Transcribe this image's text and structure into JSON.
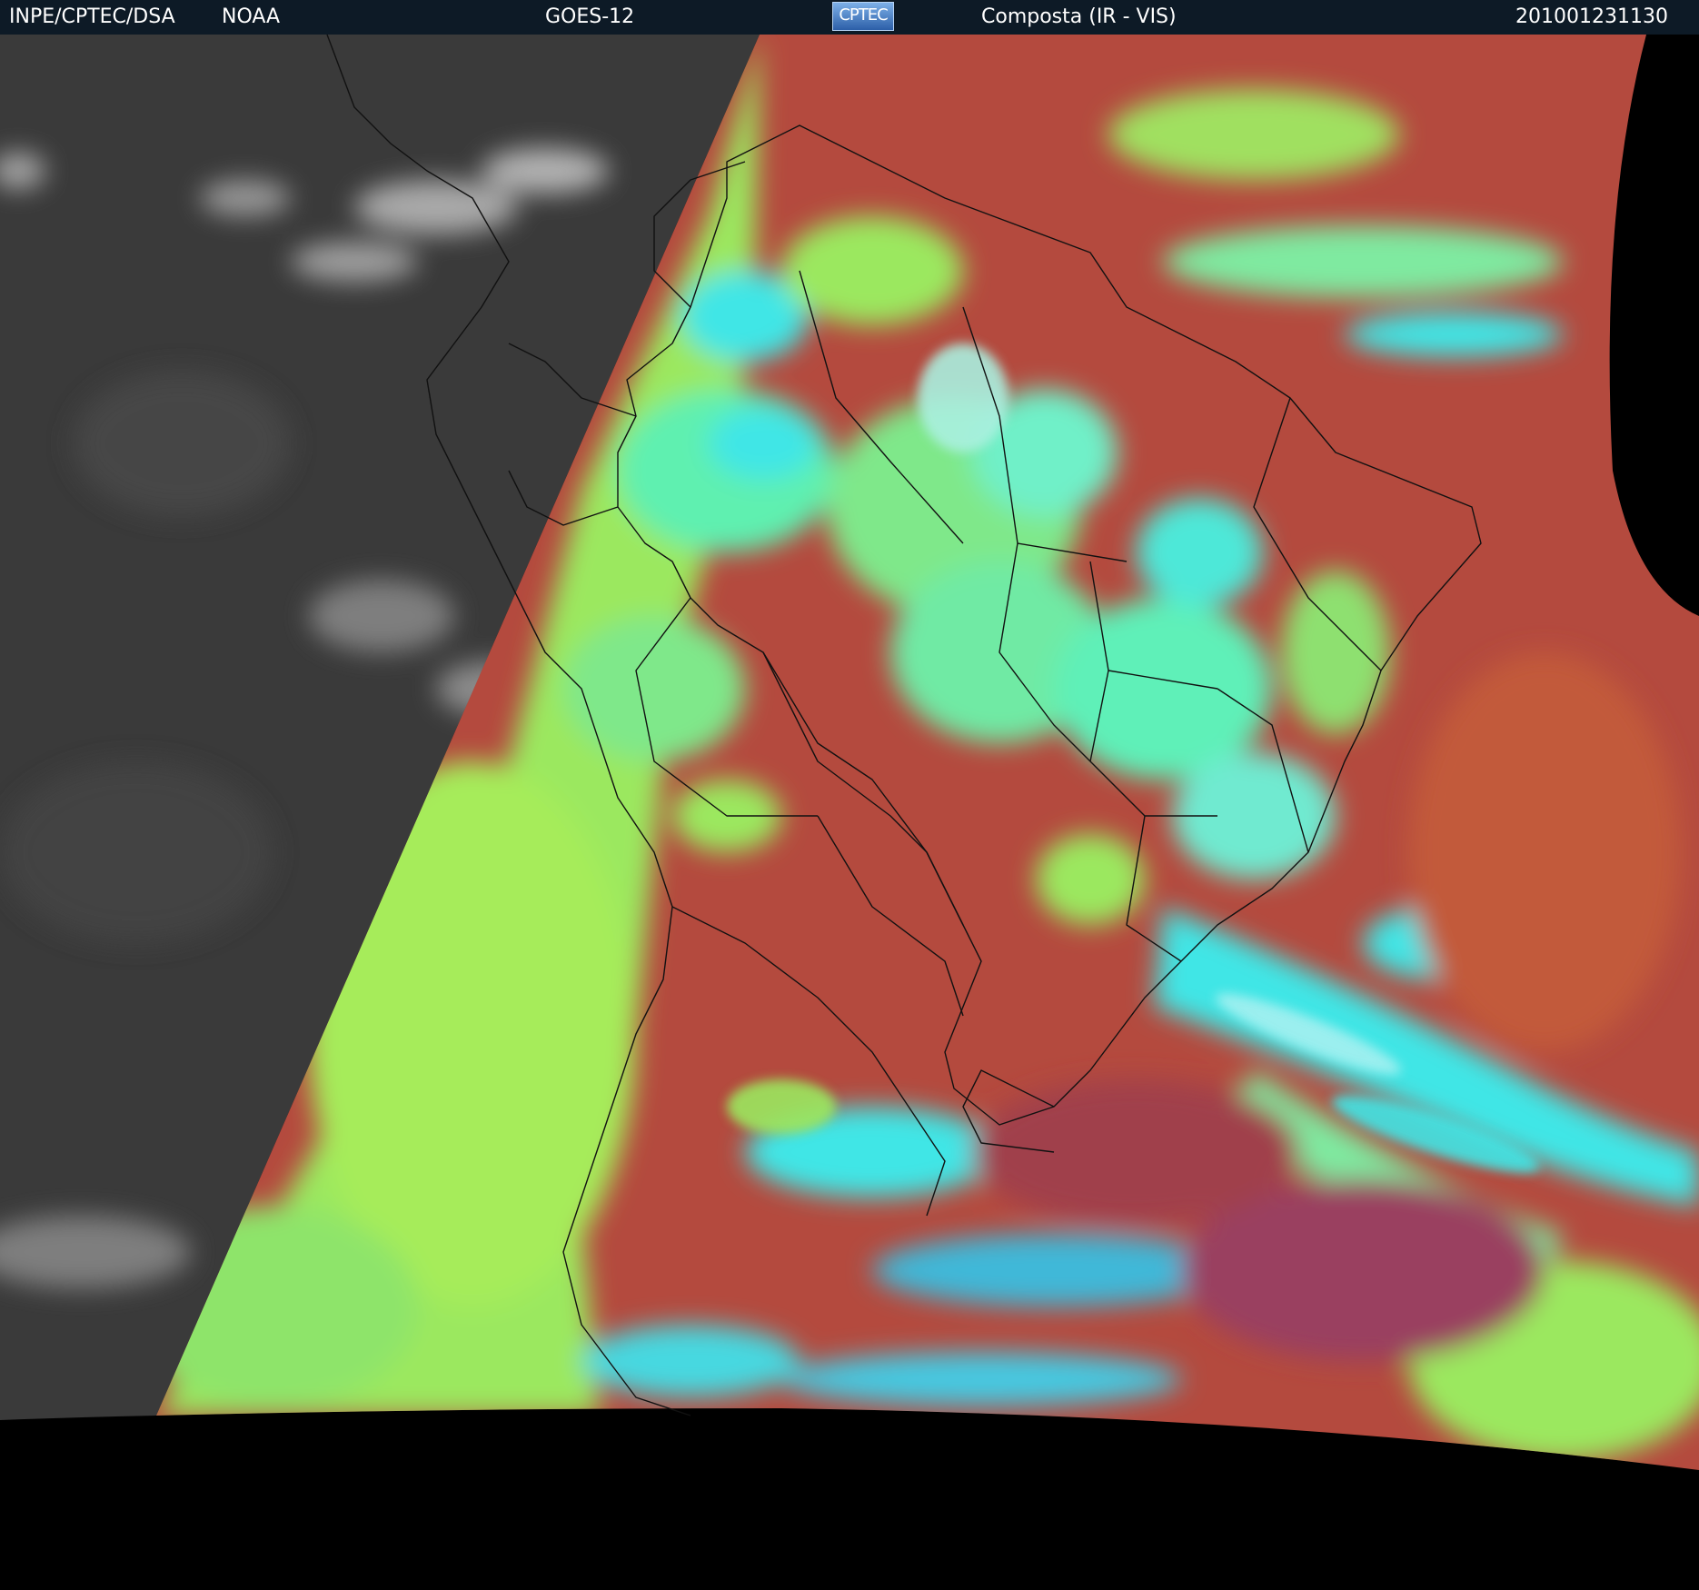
{
  "header": {
    "agency": "INPE/CPTEC/DSA",
    "partner": "NOAA",
    "satellite": "GOES-12",
    "logo_text": "CPTEC",
    "product": "Composta (IR - VIS)",
    "timestamp": "201001231130"
  },
  "colors": {
    "header_bg": "#0d1a26",
    "space": "#000000",
    "night_gray": "#3a3a3a",
    "ir_red": "#b44a3e",
    "cloud_green": "#9be85f",
    "cloud_cyan": "#3fe6e6",
    "border_line": "#111111"
  },
  "map": {
    "region": "South America",
    "imagery": "composite IR-VIS satellite imagery with political borders"
  }
}
